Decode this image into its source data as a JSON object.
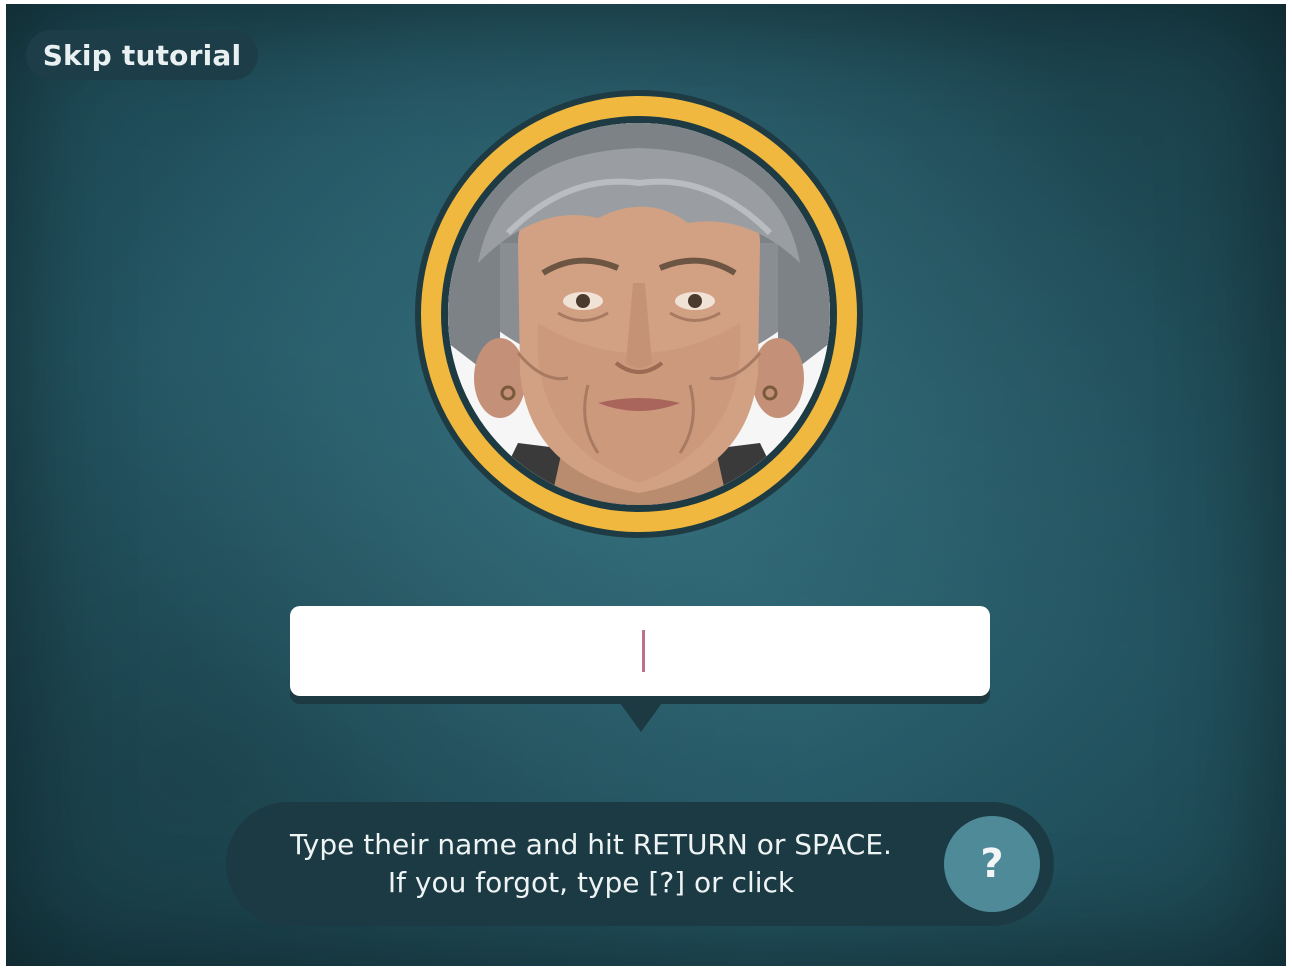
{
  "tutorial": {
    "skip_label": "Skip tutorial"
  },
  "portrait": {
    "ring_color": "#f0b83e"
  },
  "name_input": {
    "value": "",
    "placeholder": ""
  },
  "hint": {
    "line1": "Type their name and hit RETURN or SPACE.",
    "line2": "If you forgot, type [?] or click",
    "help_label": "?"
  },
  "colors": {
    "background": "#245663",
    "panel": "#1c3a43",
    "help_button": "#4f8a98"
  }
}
